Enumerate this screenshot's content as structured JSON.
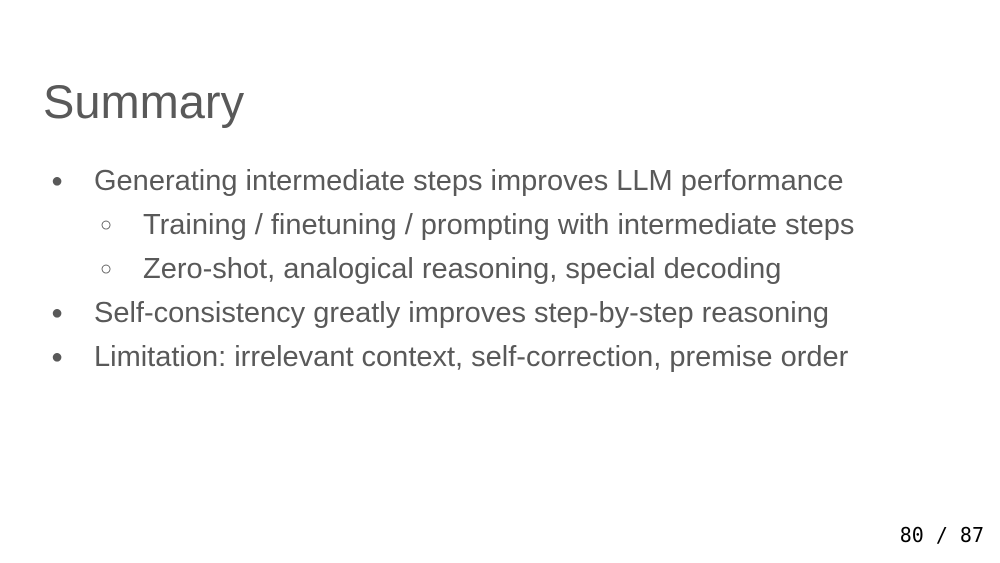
{
  "slide": {
    "title": "Summary",
    "bullets": [
      {
        "level": 1,
        "marker": "●",
        "text": "Generating intermediate steps improves LLM performance"
      },
      {
        "level": 2,
        "marker": "○",
        "text": "Training / finetuning / prompting with intermediate steps"
      },
      {
        "level": 2,
        "marker": "○",
        "text": "Zero-shot, analogical reasoning, special decoding"
      },
      {
        "level": 1,
        "marker": "●",
        "text": "Self-consistency greatly improves step-by-step reasoning"
      },
      {
        "level": 1,
        "marker": "●",
        "text": "Limitation: irrelevant context, self-correction, premise order"
      }
    ]
  },
  "page_indicator": "80 / 87",
  "colors": {
    "text": "#595959",
    "background": "#ffffff",
    "page_indicator": "#000000"
  }
}
